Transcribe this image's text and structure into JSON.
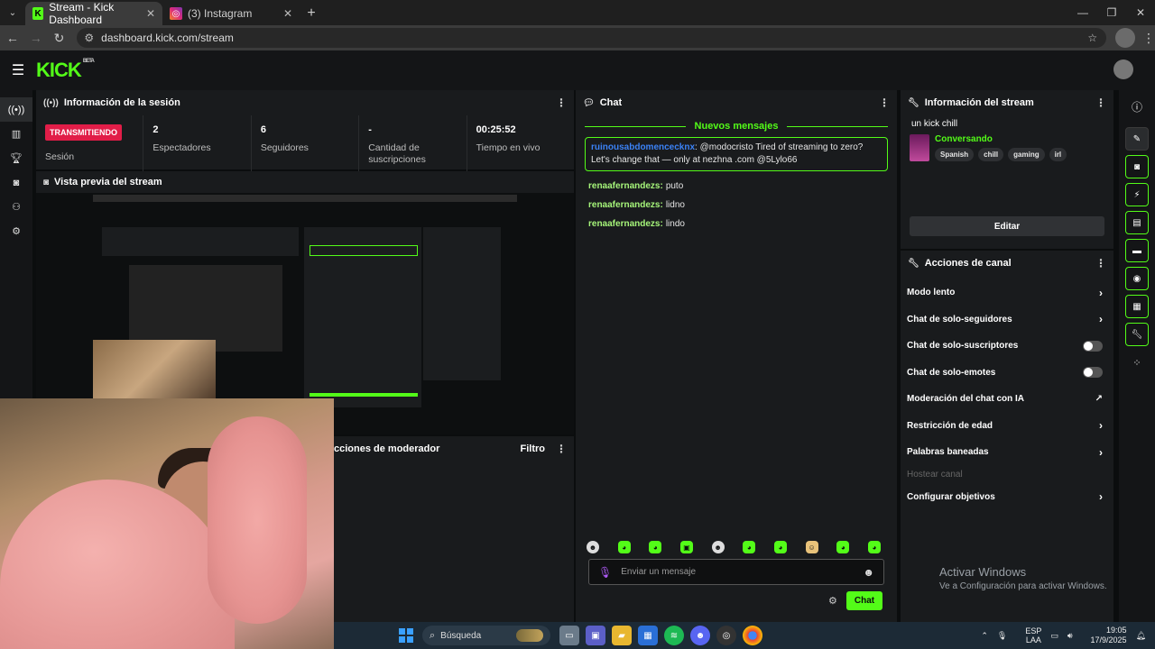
{
  "browser": {
    "tabs": [
      {
        "title": "Stream - Kick Dashboard",
        "active": true,
        "favicon": "kick-icon"
      },
      {
        "title": "(3) Instagram",
        "active": false,
        "favicon": "instagram-icon"
      }
    ],
    "url": "dashboard.kick.com/stream"
  },
  "header": {
    "logo": "KICK",
    "logo_sup": "BETA"
  },
  "session": {
    "title": "Información de la sesión",
    "status_badge": "TRANSMITIENDO",
    "stats": [
      {
        "label": "Sesión"
      },
      {
        "value": "2",
        "label": "Espectadores"
      },
      {
        "value": "6",
        "label": "Seguidores"
      },
      {
        "value": "-",
        "label": "Cantidad de suscripciones"
      },
      {
        "value": "00:25:52",
        "label": "Tiempo en vivo"
      }
    ]
  },
  "preview": {
    "title": "Vista previa del stream"
  },
  "moderator": {
    "title": "cciones de moderador",
    "filter": "Filtro"
  },
  "chat": {
    "title": "Chat",
    "new_messages": "Nuevos mensajes",
    "highlight": {
      "user": "ruinousabdomencecknx",
      "text": ": @modocristo Tired of streaming to zero? Let's change that — only at nezhna .com @5Lylo66"
    },
    "messages": [
      {
        "user": "renaafernandezs:",
        "text": "puto"
      },
      {
        "user": "renaafernandezs:",
        "text": "lidno"
      },
      {
        "user": "renaafernandezs:",
        "text": "lindo"
      }
    ],
    "input_placeholder": "Enviar un mensaje",
    "send_label": "Chat"
  },
  "stream_info": {
    "title": "Información del stream",
    "stream_title": "un kick chill",
    "category": "Conversando",
    "tags": [
      "Spanish",
      "chill",
      "gaming",
      "irl"
    ],
    "edit_label": "Editar"
  },
  "actions": {
    "title": "Acciones de canal",
    "items": [
      {
        "label": "Modo lento",
        "kind": "chevron"
      },
      {
        "label": "Chat de solo-seguidores",
        "kind": "chevron"
      },
      {
        "label": "Chat de solo-suscriptores",
        "kind": "toggle"
      },
      {
        "label": "Chat de solo-emotes",
        "kind": "toggle"
      },
      {
        "label": "Moderación del chat con IA",
        "kind": "external"
      },
      {
        "label": "Restricción de edad",
        "kind": "chevron"
      },
      {
        "label": "Palabras baneadas",
        "kind": "chevron"
      },
      {
        "label": "Hostear canal",
        "kind": "disabled"
      },
      {
        "label": "Configurar objetivos",
        "kind": "chevron"
      }
    ]
  },
  "watermark": {
    "line1": "Activar Windows",
    "line2": "Ve a Configuración para activar Windows."
  },
  "taskbar": {
    "search": "Búsqueda",
    "lang1": "ESP",
    "lang2": "LAA",
    "time": "19:05",
    "date": "17/9/2025"
  }
}
